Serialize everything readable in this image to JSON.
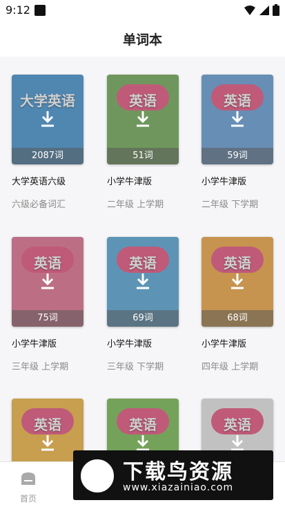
{
  "status_bar": {
    "time": "9:12"
  },
  "header": {
    "title": "单词本"
  },
  "books": [
    {
      "cover_title": "大学英语",
      "count": "2087词",
      "name": "大学英语六级",
      "subtitle": "六级必备词汇",
      "cover_color": "#3a8fd0"
    },
    {
      "cover_title": "英语",
      "count": "51词",
      "name": "小学牛津版",
      "subtitle": "二年级 上学期",
      "cover_color": "#6aa84f"
    },
    {
      "cover_title": "英语",
      "count": "59词",
      "name": "小学牛津版",
      "subtitle": "二年级 下学期",
      "cover_color": "#5e9ad6"
    },
    {
      "cover_title": "英语",
      "count": "75词",
      "name": "小学牛津版",
      "subtitle": "三年级 上学期",
      "cover_color": "#e06a8a"
    },
    {
      "cover_title": "英语",
      "count": "69词",
      "name": "小学牛津版",
      "subtitle": "三年级 下学期",
      "cover_color": "#4fa3d8"
    },
    {
      "cover_title": "英语",
      "count": "68词",
      "name": "小学牛津版",
      "subtitle": "四年级 上学期",
      "cover_color": "#f0a33a"
    },
    {
      "cover_title": "英语",
      "count": "",
      "name": "",
      "subtitle": "",
      "cover_color": "#f2b43a"
    },
    {
      "cover_title": "英语",
      "count": "",
      "name": "",
      "subtitle": "",
      "cover_color": "#74b84a"
    },
    {
      "cover_title": "英语",
      "count": "",
      "name": "",
      "subtitle": "",
      "cover_color": "#e8e8e8"
    }
  ],
  "tabbar": {
    "home_label": "首页"
  },
  "watermark": {
    "brand": "下载鸟资源",
    "url": "www.xiazainiao.com"
  }
}
